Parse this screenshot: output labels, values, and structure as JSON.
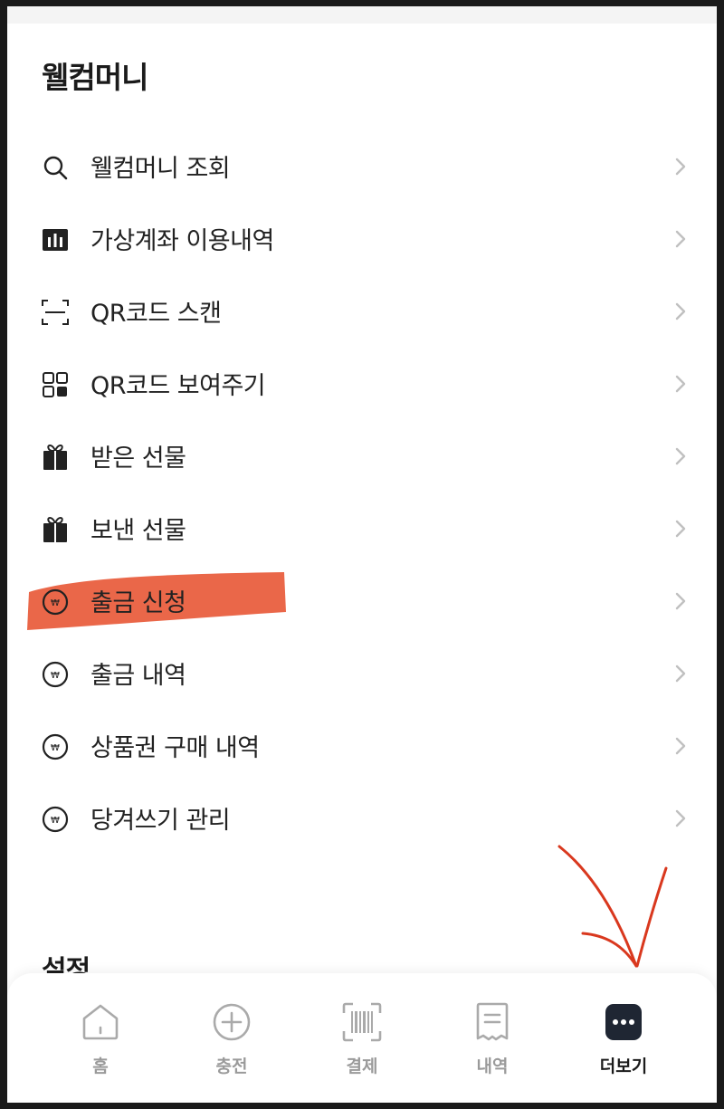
{
  "section": {
    "title": "웰컴머니"
  },
  "menu": {
    "items": [
      {
        "label": "웰컴머니 조회",
        "icon": "search-icon"
      },
      {
        "label": "가상계좌 이용내역",
        "icon": "bar-chart-icon"
      },
      {
        "label": "QR코드 스캔",
        "icon": "qr-scan-icon"
      },
      {
        "label": "QR코드 보여주기",
        "icon": "qr-grid-icon"
      },
      {
        "label": "받은 선물",
        "icon": "gift-icon"
      },
      {
        "label": "보낸 선물",
        "icon": "gift-icon"
      },
      {
        "label": "출금 신청",
        "icon": "won-coin-icon"
      },
      {
        "label": "출금 내역",
        "icon": "won-coin-icon"
      },
      {
        "label": "상품권 구매 내역",
        "icon": "won-coin-icon"
      },
      {
        "label": "당겨쓰기 관리",
        "icon": "won-coin-icon"
      }
    ]
  },
  "next_section": {
    "title": "설정"
  },
  "bottom_nav": {
    "items": [
      {
        "label": "홈",
        "icon": "home-icon"
      },
      {
        "label": "충전",
        "icon": "plus-circle-icon"
      },
      {
        "label": "결제",
        "icon": "barcode-icon"
      },
      {
        "label": "내역",
        "icon": "receipt-icon"
      },
      {
        "label": "더보기",
        "icon": "more-icon",
        "active": true
      }
    ]
  },
  "colors": {
    "highlight": "#e85a3a",
    "annotation_arrow": "#d9381e",
    "text": "#222222",
    "muted": "#9a9a9a"
  }
}
